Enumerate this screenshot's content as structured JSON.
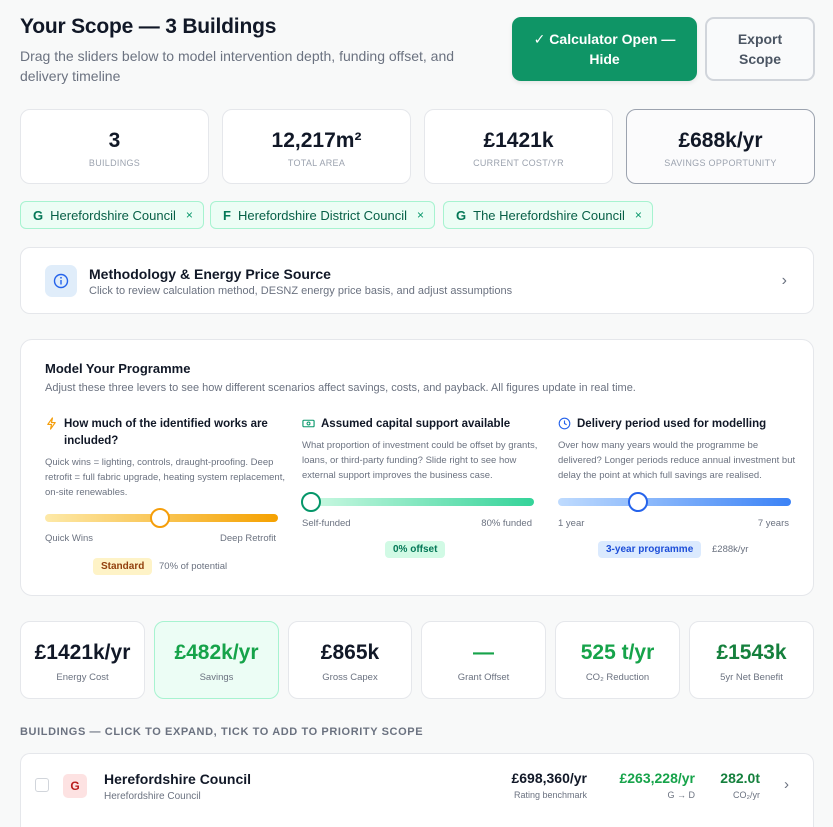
{
  "header": {
    "title": "Your Scope — 3 Buildings",
    "subtitle": "Drag the sliders below to model intervention depth, funding offset, and delivery timeline",
    "primary_button": "✓ Calculator Open — Hide",
    "secondary_button": "Export Scope"
  },
  "stats": [
    {
      "value": "3",
      "label": "BUILDINGS"
    },
    {
      "value": "12,217m²",
      "label": "TOTAL AREA"
    },
    {
      "value": "£1421k",
      "label": "CURRENT COST/YR"
    },
    {
      "value": "£688k/yr",
      "label": "SAVINGS OPPORTUNITY"
    }
  ],
  "chips": [
    {
      "grade": "G",
      "name": "Herefordshire Council",
      "remove": "×"
    },
    {
      "grade": "F",
      "name": "Herefordshire District Council",
      "remove": "×"
    },
    {
      "grade": "G",
      "name": "The Herefordshire Council",
      "remove": "×"
    }
  ],
  "methodology": {
    "title": "Methodology & Energy Price Source",
    "subtitle": "Click to review calculation method, DESNZ energy price basis, and adjust assumptions",
    "icon": "info-icon"
  },
  "programme": {
    "title": "Model Your Programme",
    "subtitle": "Adjust these three levers to see how different scenarios affect savings, costs, and payback. All figures update in real time.",
    "levers": [
      {
        "icon": "lightning-icon",
        "title": "How much of the identified works are included?",
        "description": "Quick wins = lighting, controls, draught-proofing. Deep retrofit = full fabric upgrade, heating system replacement, on-site renewables.",
        "min_label": "Quick Wins",
        "max_label": "Deep Retrofit",
        "position": 0.5,
        "badge": "Standard",
        "note": "70% of potential"
      },
      {
        "icon": "money-icon",
        "title": "Assumed capital support available",
        "description": "What proportion of investment could be offset by grants, loans, or third-party funding? Slide right to see how external support improves the business case.",
        "min_label": "Self-funded",
        "max_label": "80% funded",
        "position": 0,
        "badge": "0% offset",
        "note": ""
      },
      {
        "icon": "clock-icon",
        "title": "Delivery period used for modelling",
        "description": "Over how many years would the programme be delivered? Longer periods reduce annual investment but delay the point at which full savings are realised.",
        "min_label": "1 year",
        "max_label": "7 years",
        "position": 0.333,
        "badge": "3-year programme",
        "note": "£288k/yr"
      }
    ]
  },
  "metrics": [
    {
      "value": "£1421k/yr",
      "label": "Energy Cost",
      "color": "#111827"
    },
    {
      "value": "£482k/yr",
      "label": "Savings",
      "color": "#16a34a"
    },
    {
      "value": "£865k",
      "label": "Gross Capex",
      "color": "#111827"
    },
    {
      "value": "—",
      "label": "Grant Offset",
      "color": "#16a34a"
    },
    {
      "value": "525 t/yr",
      "label": "CO₂ Reduction",
      "color": "#16a34a"
    },
    {
      "value": "£1543k",
      "label": "5yr Net Benefit",
      "color": "#15803d"
    }
  ],
  "buildings_section": {
    "heading": "BUILDINGS — CLICK TO EXPAND, TICK TO ADD TO PRIORITY SCOPE"
  },
  "buildings": [
    {
      "grade": "G",
      "name": "Herefordshire Council",
      "org": "Herefordshire Council",
      "cost": "£698,360/yr",
      "cost_label": "Rating benchmark",
      "savings": "£263,228/yr",
      "savings_label": "G → D",
      "co2": "282.0t",
      "co2_label": "CO₂/yr"
    }
  ],
  "colors": {
    "primary": "#0f9566",
    "accent_green": "#16a34a",
    "amber": "#f59e0b",
    "blue": "#3b82f6"
  }
}
